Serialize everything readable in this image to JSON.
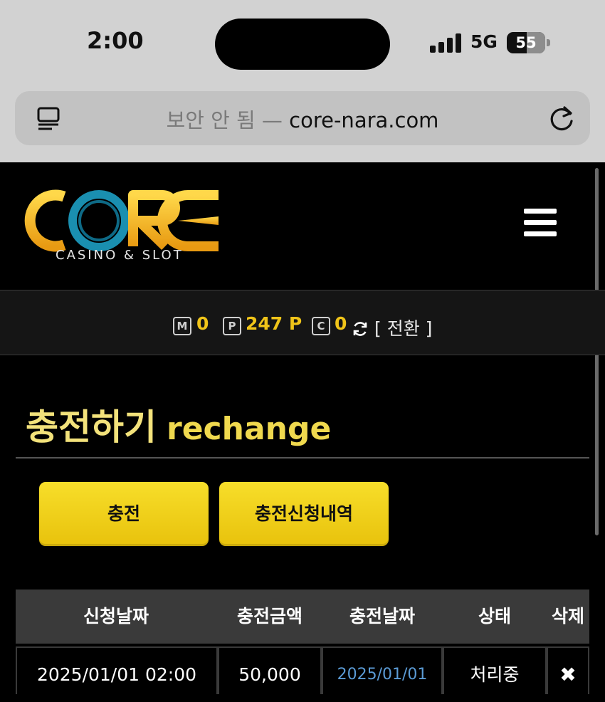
{
  "status_bar": {
    "time": "2:00",
    "network": "5G",
    "battery": "55"
  },
  "browser": {
    "insecure_label": "보안 안 됨 —",
    "domain": "core-nara.com",
    "reader_icon": "reader-icon",
    "reload_icon": "reload-icon"
  },
  "site": {
    "logo_text": "CORE",
    "logo_sub": "CASINO & SLOT",
    "menu_icon": "hamburger-menu-icon",
    "brand_colors": {
      "gold": "#f0c419",
      "yellow": "#f7de2a",
      "teal": "#1a8fb0"
    }
  },
  "balance": {
    "money_badge": "M",
    "money_value": "0",
    "point_badge": "P",
    "point_value": "247 P",
    "casino_badge": "C",
    "casino_value": "0",
    "switch_label": "[ 전환 ]"
  },
  "page": {
    "title": "충전하기",
    "subtitle": "rechange"
  },
  "buttons": {
    "charge": "충전",
    "history": "충전신청내역"
  },
  "table": {
    "headers": [
      "신청날짜",
      "충전금액",
      "충전날짜",
      "상태",
      "삭제"
    ],
    "rows": [
      {
        "request_date": "2025/01/01 02:00",
        "amount": "50,000",
        "charge_date": "2025/01/01",
        "status": "처리중",
        "delete": "✖"
      }
    ]
  }
}
